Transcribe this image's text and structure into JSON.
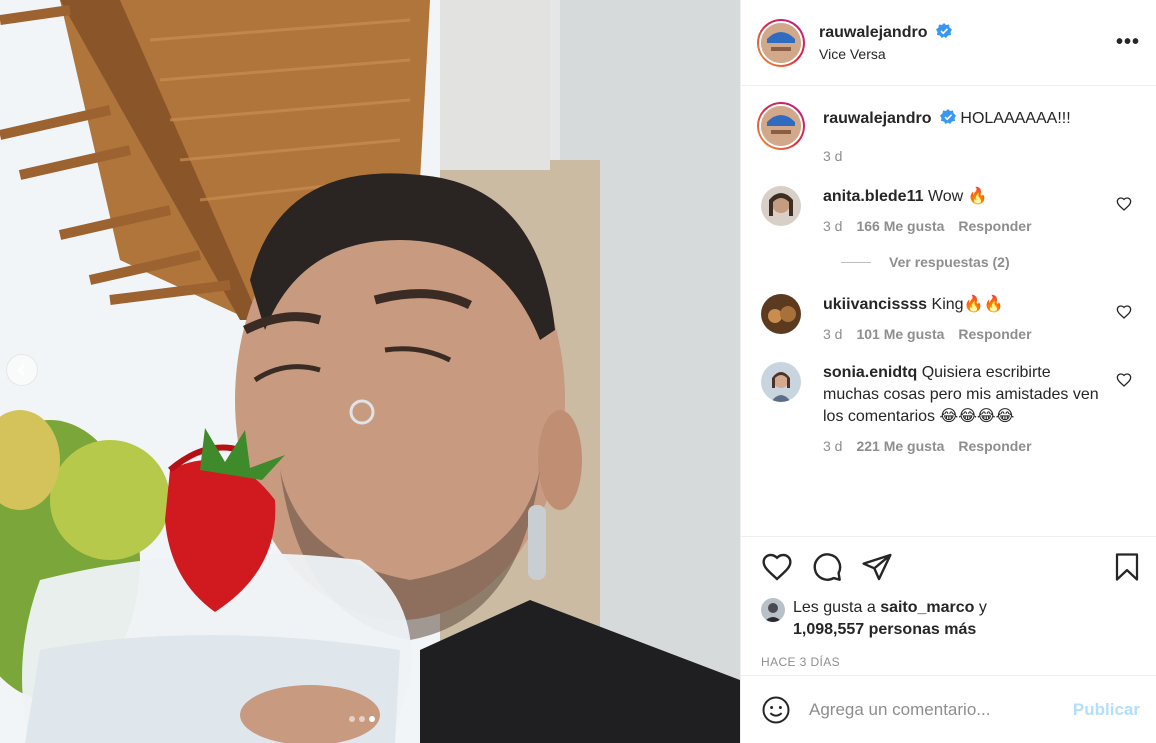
{
  "post": {
    "username": "rauwalejandro",
    "location": "Vice Versa",
    "caption": "HOLAAAAAA!!!",
    "caption_age": "3 d",
    "carousel": {
      "total": 3,
      "active_index": 2
    }
  },
  "comments": [
    {
      "username": "anita.blede11",
      "text": "Wow 🔥",
      "age": "3 d",
      "likes": "166 Me gusta",
      "reply": "Responder",
      "avatar_color": "#6b5a4a"
    },
    {
      "username": "ukiivancissss",
      "text": "King🔥🔥",
      "age": "3 d",
      "likes": "101 Me gusta",
      "reply": "Responder",
      "avatar_color": "#7a4d2c"
    },
    {
      "username": "sonia.enidtq",
      "text": "Quisiera escribirte muchas cosas pero mis amistades ven los comentarios 😂😂😂😂",
      "age": "3 d",
      "likes": "221 Me gusta",
      "reply": "Responder",
      "avatar_color": "#5a6e8a"
    }
  ],
  "replies_toggle": "Ver respuestas (2)",
  "likes": {
    "prefix": "Les gusta a",
    "user": "saito_marco",
    "connector": "y",
    "count": "1,098,557 personas más"
  },
  "timestamp": "HACE 3 DÍAS",
  "add_comment": {
    "placeholder": "Agrega un comentario...",
    "publish_label": "Publicar"
  },
  "colors": {
    "verified": "#3897f0",
    "publish_disabled": "#b2dffc",
    "meta": "#8e8e8e"
  },
  "icons": {
    "more": "more-options-icon",
    "heart": "heart-icon",
    "comment": "comment-icon",
    "share": "share-icon",
    "save": "bookmark-icon",
    "emoji": "emoji-icon",
    "prev": "chevron-left-icon"
  }
}
